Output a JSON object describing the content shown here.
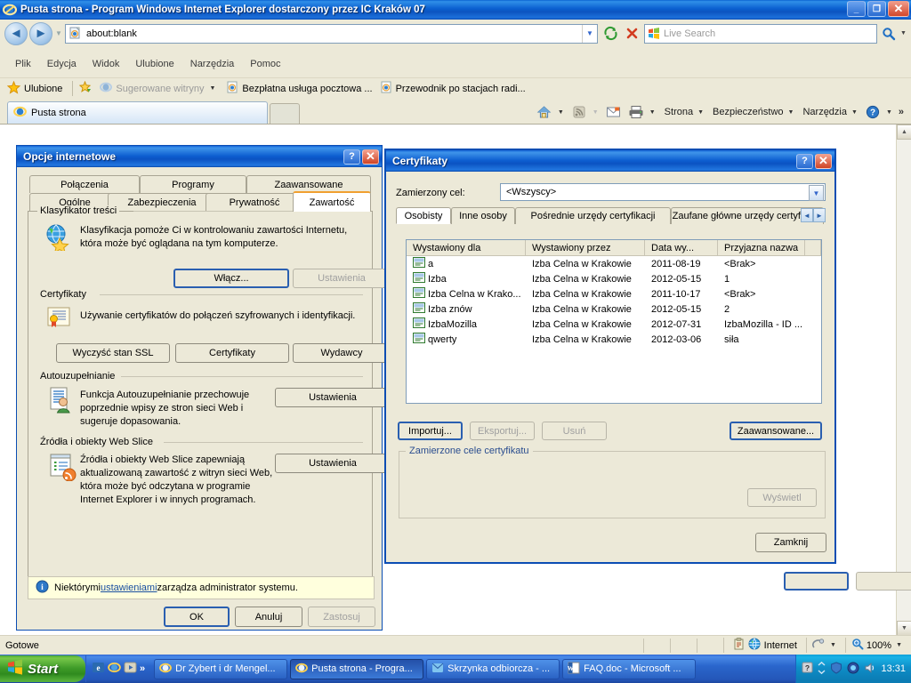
{
  "browser": {
    "window_title": "Pusta strona - Program Windows Internet Explorer dostarczony przez IC Kraków 07",
    "title_icon": "ie-logo-icon",
    "window_buttons": {
      "minimize": "_",
      "maximize": "❐",
      "close": "✕"
    },
    "address": {
      "value": "about:blank",
      "icon": "ie-page-icon"
    },
    "nav": {
      "back": "◄",
      "forward": "►",
      "refresh": "refresh-icon",
      "stop": "stop-icon"
    },
    "search": {
      "placeholder": "Live Search",
      "logo": "windows-live-logo-icon",
      "go": "search-icon"
    },
    "menu": [
      "Plik",
      "Edycja",
      "Widok",
      "Ulubione",
      "Narzędzia",
      "Pomoc"
    ],
    "favorites_bar": {
      "favorites_label": "Ulubione",
      "add_icon": "add-favorite-icon",
      "items": [
        {
          "label": "Sugerowane witryny",
          "icon": "ie-logo-icon",
          "has_dropdown": true,
          "dim": true
        },
        {
          "label": "Bezpłatna usługa pocztowa ...",
          "icon": "ie-logo-icon",
          "has_dropdown": false,
          "dim": false
        },
        {
          "label": "Przewodnik po stacjach radi...",
          "icon": "ie-logo-icon",
          "has_dropdown": false,
          "dim": false
        }
      ]
    },
    "tabs": [
      {
        "label": "Pusta strona",
        "icon": "ie-logo-icon",
        "selected": true
      }
    ],
    "new_tab_label": "",
    "command_bar": {
      "home": "home-icon",
      "feeds": "rss-icon",
      "mail": "mail-icon",
      "print": "printer-icon",
      "items": [
        "Strona",
        "Bezpieczeństwo",
        "Narzędzia"
      ],
      "help": "help-icon",
      "overflow": "»"
    },
    "status_bar": {
      "status": "Gotowe",
      "zone_icon": "globe-icon",
      "zone": "Internet",
      "protected_icon": "protected-mode-icon",
      "zoom_icon": "zoom-icon",
      "zoom": "100%"
    }
  },
  "internet_options": {
    "title": "Opcje internetowe",
    "help_button": "?",
    "close_button": "✕",
    "tabs_row1": [
      "Połączenia",
      "Programy",
      "Zaawansowane"
    ],
    "tabs_row2": [
      "Ogólne",
      "Zabezpieczenia",
      "Prywatność",
      "Zawartość"
    ],
    "selected_tab": "Zawartość",
    "sections": [
      {
        "legend": "Klasyfikator treści",
        "icon": "content-advisor-icon",
        "description": "Klasyfikacja pomoże Ci w kontrolowaniu zawartości Internetu, która może być oglądana na tym komputerze.",
        "buttons": [
          {
            "label": "Włącz...",
            "enabled": true,
            "default": true
          },
          {
            "label": "Ustawienia",
            "enabled": false,
            "default": false
          }
        ]
      },
      {
        "legend": "Certyfikaty",
        "icon": "certificate-icon",
        "description": "Używanie certyfikatów do połączeń szyfrowanych i identyfikacji.",
        "buttons": [
          {
            "label": "Wyczyść stan SSL",
            "enabled": true,
            "default": false
          },
          {
            "label": "Certyfikaty",
            "enabled": true,
            "default": false
          },
          {
            "label": "Wydawcy",
            "enabled": true,
            "default": false
          }
        ]
      },
      {
        "legend": "Autouzupełnianie",
        "icon": "autocomplete-icon",
        "description": "Funkcja Autouzupełnianie przechowuje poprzednie wpisy ze stron sieci Web i sugeruje dopasowania.",
        "buttons": [
          {
            "label": "Ustawienia",
            "enabled": true,
            "default": false
          }
        ]
      },
      {
        "legend": "Źródła i obiekty Web Slice",
        "icon": "web-slice-icon",
        "description": "Źródła i obiekty Web Slice zapewniają aktualizowaną zawartość z witryn sieci Web, która może być odczytana w programie Internet Explorer i w innych programach.",
        "buttons": [
          {
            "label": "Ustawienia",
            "enabled": true,
            "default": false
          }
        ]
      }
    ],
    "admin_notice": {
      "icon": "info-icon",
      "prefix": "Niektórymi ",
      "link": "ustawieniami",
      "suffix": " zarządza administrator systemu."
    },
    "footer_buttons": [
      {
        "label": "OK",
        "enabled": true,
        "default": true
      },
      {
        "label": "Anuluj",
        "enabled": true,
        "default": false
      },
      {
        "label": "Zastosuj",
        "enabled": false,
        "default": false
      }
    ]
  },
  "certificates": {
    "title": "Certyfikaty",
    "help_button": "?",
    "close_button": "✕",
    "purpose_label": "Zamierzony cel:",
    "purpose_value": "<Wszyscy>",
    "tabs": [
      "Osobisty",
      "Inne osoby",
      "Pośrednie urzędy certyfikacji",
      "Zaufane główne urzędy certyfikacji"
    ],
    "selected_tab": "Osobisty",
    "tab_scroll_left": "◄",
    "tab_scroll_right": "►",
    "columns": [
      "Wystawiony dla",
      "Wystawiony przez",
      "Data wy...",
      "Przyjazna nazwa"
    ],
    "rows": [
      {
        "icon": "certificate-small-icon",
        "issued_to": "a",
        "issued_by": "Izba Celna w Krakowie",
        "expiry": "2011-08-19",
        "friendly_name": "<Brak>"
      },
      {
        "icon": "certificate-small-icon",
        "issued_to": "Izba",
        "issued_by": "Izba Celna w Krakowie",
        "expiry": "2012-05-15",
        "friendly_name": "1"
      },
      {
        "icon": "certificate-small-icon",
        "issued_to": "Izba Celna w Krako...",
        "issued_by": "Izba Celna w Krakowie",
        "expiry": "2011-10-17",
        "friendly_name": "<Brak>"
      },
      {
        "icon": "certificate-small-icon",
        "issued_to": "Izba znów",
        "issued_by": "Izba Celna w Krakowie",
        "expiry": "2012-05-15",
        "friendly_name": "2"
      },
      {
        "icon": "certificate-small-icon",
        "issued_to": "IzbaMozilla",
        "issued_by": "Izba Celna w Krakowie",
        "expiry": "2012-07-31",
        "friendly_name": "IzbaMozilla - ID ..."
      },
      {
        "icon": "certificate-small-icon",
        "issued_to": "qwerty",
        "issued_by": "Izba Celna w Krakowie",
        "expiry": "2012-03-06",
        "friendly_name": "siła"
      }
    ],
    "action_buttons": [
      {
        "label": "Importuj...",
        "enabled": true,
        "default": true
      },
      {
        "label": "Eksportuj...",
        "enabled": false,
        "default": false
      },
      {
        "label": "Usuń",
        "enabled": false,
        "default": false
      }
    ],
    "advanced_button": {
      "label": "Zaawansowane...",
      "enabled": true,
      "default": true
    },
    "purposes_legend": "Zamierzone cele certyfikatu",
    "view_button": {
      "label": "Wyświetl",
      "enabled": false
    },
    "close_label": "Zamknij"
  },
  "taskbar": {
    "start_label": "Start",
    "start_icon": "windows-flag-icon",
    "quick_launch": [
      "outlook-icon",
      "ie-icon",
      "media-icon"
    ],
    "quick_launch_overflow": "»",
    "tasks": [
      {
        "label": "Dr Zybert i dr Mengel...",
        "icon": "ie-logo-icon",
        "active": false
      },
      {
        "label": "Pusta strona - Progra...",
        "icon": "ie-logo-icon",
        "active": true
      },
      {
        "label": "Skrzynka odbiorcza - ...",
        "icon": "outlook-icon",
        "active": false
      },
      {
        "label": "FAQ.doc - Microsoft ...",
        "icon": "word-icon",
        "active": false
      }
    ],
    "tray_icons": [
      "unknown-icon",
      "network-icon",
      "volume-icon",
      "shield-icon"
    ],
    "clock": "13:31"
  }
}
